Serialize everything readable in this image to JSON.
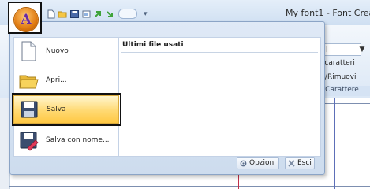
{
  "window": {
    "title": "My font1 - Font Crea"
  },
  "app_button": {
    "letter": "A"
  },
  "quick_access": {
    "icons": [
      "new-file-icon",
      "open-folder-icon",
      "save-icon",
      "print-icon",
      "undo-icon",
      "redo-icon"
    ],
    "dropdown_glyph": "▾"
  },
  "ribbon": {
    "field_text": "T",
    "field_arrow": "▼",
    "line1": "a caratteri",
    "line2": "ngi/Rimuovi",
    "group_label": "Carattere"
  },
  "menu": {
    "items": [
      {
        "label": "Nuovo",
        "icon": "new-document-icon"
      },
      {
        "label": "Apri...",
        "icon": "open-folder-icon"
      },
      {
        "label": "Salva",
        "icon": "floppy-disk-icon"
      },
      {
        "label": "Salva con nome...",
        "icon": "save-as-icon"
      }
    ],
    "recent_header": "Ultimi file usati",
    "options_button": "Opzioni",
    "exit_button": "Esci"
  },
  "colors": {
    "highlight": "#ffd972",
    "guide_red": "#c0304a",
    "guide_blue": "#5d6fb8"
  }
}
